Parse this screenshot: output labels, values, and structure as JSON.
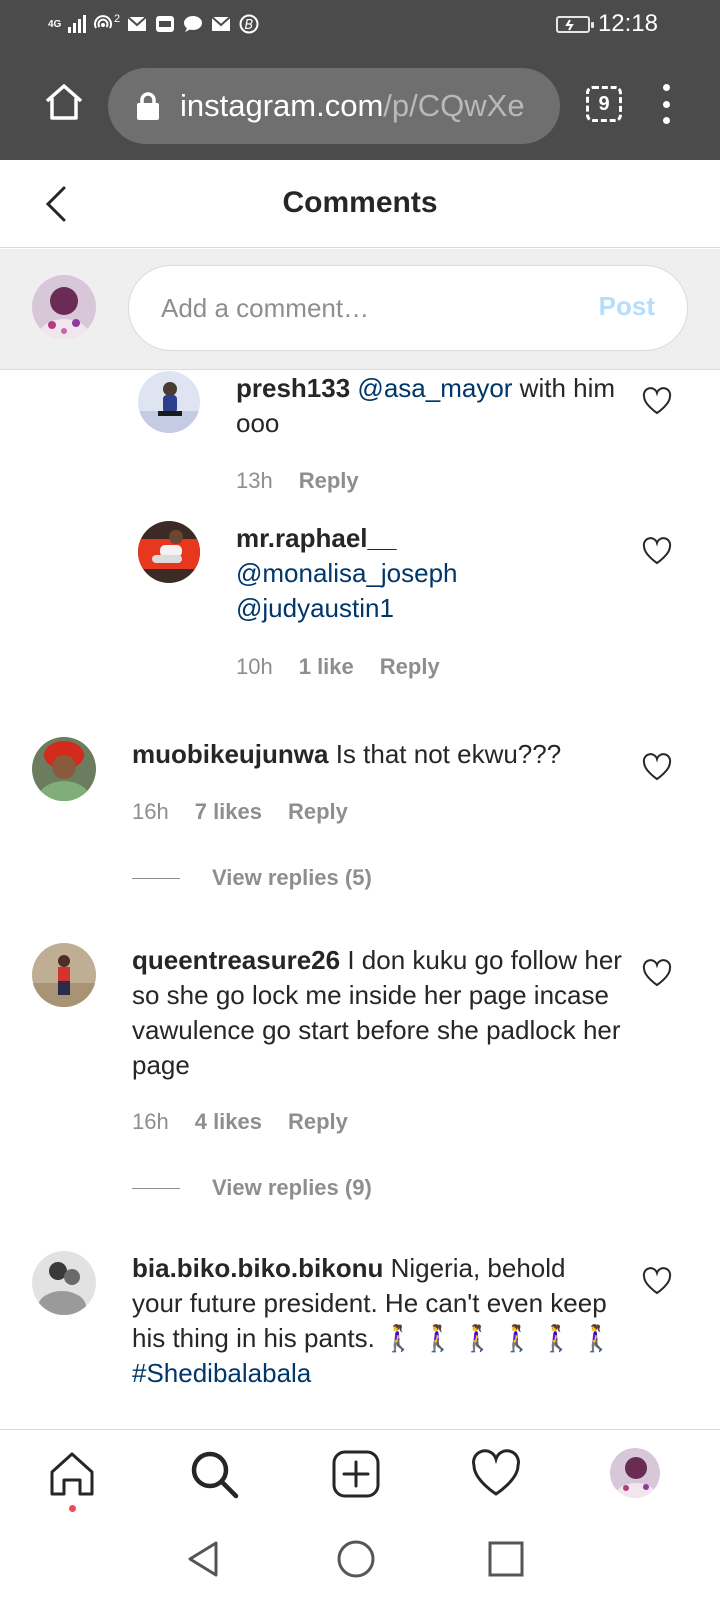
{
  "status_bar": {
    "network": "4G",
    "hotspot_count": "2",
    "time": "12:18",
    "icons": [
      "signal-icon",
      "hotspot-icon",
      "mail-icon",
      "gallery-icon",
      "message-icon",
      "mail-icon",
      "app-icon",
      "battery-icon"
    ]
  },
  "browser": {
    "url_host": "instagram.com",
    "url_path": "/p/CQwXe",
    "tab_count": "9"
  },
  "header": {
    "title": "Comments"
  },
  "compose": {
    "placeholder": "Add a comment…",
    "post_label": "Post"
  },
  "comments": [
    {
      "username": "presh133",
      "mention": "@asa_mayor",
      "text": " with him ooo",
      "time": "13h",
      "likes": "",
      "reply_label": "Reply"
    },
    {
      "username": "mr.raphael__",
      "mention1": "@monalisa_joseph",
      "mention2": "@judyaustin1",
      "time": "10h",
      "likes": "1 like",
      "reply_label": "Reply"
    },
    {
      "username": "muobikeujunwa",
      "text": "Is that not ekwu???",
      "time": "16h",
      "likes": "7 likes",
      "reply_label": "Reply",
      "view_replies": "View replies (5)"
    },
    {
      "username": "queentreasure26",
      "text": "I don kuku go follow her so she go lock me inside her page incase vawulence go start before she padlock her page",
      "time": "16h",
      "likes": "4 likes",
      "reply_label": "Reply",
      "view_replies": "View replies (9)"
    },
    {
      "username": "bia.biko.biko.bikonu",
      "text": "Nigeria, behold your future president. He can't even keep his thing in his pants.",
      "emoji": "🚶‍♀️ 🚶‍♀️ 🚶‍♀️ 🚶‍♀️ 🚶‍♀️ 🚶‍♀️",
      "hashtag": "#Shedibalabala"
    }
  ],
  "colors": {
    "browser_bg": "#4b4b4b",
    "url_bg": "#6f6f6f",
    "mention": "#00376b",
    "meta": "#8e8e8e",
    "post_disabled": "#b2dffc",
    "notification_dot": "#ed4956"
  },
  "bottom_nav": [
    "home-icon",
    "search-icon",
    "new-post-icon",
    "activity-heart-icon",
    "profile-avatar"
  ],
  "system_nav": [
    "back-triangle-icon",
    "home-circle-icon",
    "recents-square-icon"
  ]
}
